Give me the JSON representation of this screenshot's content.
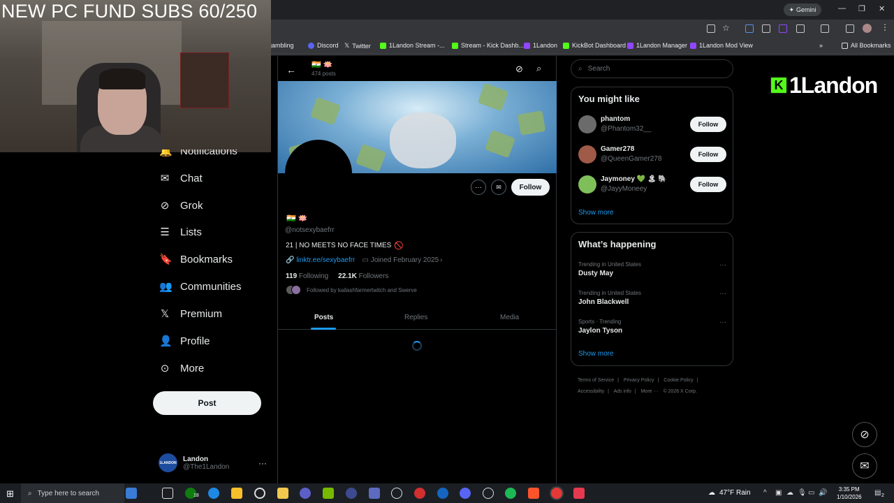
{
  "stream": {
    "overlay_title": "NEW PC FUND SUBS 60/250"
  },
  "browser": {
    "gemini_label": "Gemini",
    "bookmarks": [
      {
        "label": "gambling",
        "color": "#7b5fd6"
      },
      {
        "label": "Discord",
        "color": "#5865f2"
      },
      {
        "label": "Twitter",
        "color": "#000000"
      },
      {
        "label": "1Landon Stream -...",
        "color": "#53fc18"
      },
      {
        "label": "Stream - Kick Dashb...",
        "color": "#53fc18"
      },
      {
        "label": "1Landon",
        "color": "#9146ff"
      },
      {
        "label": "KickBot Dashboard",
        "color": "#53fc18"
      },
      {
        "label": "1Landon Manager",
        "color": "#9146ff"
      },
      {
        "label": "1Landon Mod View",
        "color": "#9146ff"
      }
    ],
    "all_bookmarks": "All Bookmarks"
  },
  "nav": {
    "items": [
      {
        "label": "Notifications",
        "icon": "bell-icon"
      },
      {
        "label": "Chat",
        "icon": "mail-icon"
      },
      {
        "label": "Grok",
        "icon": "grok-icon"
      },
      {
        "label": "Lists",
        "icon": "list-icon"
      },
      {
        "label": "Bookmarks",
        "icon": "bookmark-icon"
      },
      {
        "label": "Communities",
        "icon": "people-icon"
      },
      {
        "label": "Premium",
        "icon": "x-logo-icon"
      },
      {
        "label": "Profile",
        "icon": "person-icon"
      },
      {
        "label": "More",
        "icon": "more-circle-icon"
      }
    ],
    "post_label": "Post",
    "account": {
      "name": "Landon",
      "handle": "@The1Landon",
      "avatar_text": "1LANDON"
    }
  },
  "profile": {
    "header_flags": "🇮🇳 🪷",
    "posts_count": "474 posts",
    "flags": "🇮🇳 🪷",
    "handle": "@notsexybaefrr",
    "bio": "21 | NO MEETS NO FACE TIMES",
    "link": "linktr.ee/sexybaefrr",
    "joined": "Joined February 2025",
    "following_count": "119",
    "following_label": "Following",
    "followers_count": "22.1K",
    "followers_label": "Followers",
    "followed_by": "Followed by kailashfarmertwitch and Swerve",
    "follow_label": "Follow",
    "tabs": [
      "Posts",
      "Replies",
      "Media"
    ]
  },
  "sidebar": {
    "search_placeholder": "Search",
    "you_might_like_title": "You might like",
    "suggestions": [
      {
        "name": "phantom",
        "handle": "@Phantom32__",
        "follow": "Follow",
        "color": "#6b6b6b"
      },
      {
        "name": "Gamer278",
        "handle": "@QueenGamer278",
        "follow": "Follow",
        "color": "#a05a48"
      },
      {
        "name": "Jaymoney 💚 🏝 🐘",
        "handle": "@JayyMoneey",
        "follow": "Follow",
        "color": "#7fbf5a"
      }
    ],
    "show_more": "Show more",
    "whats_happening_title": "What’s happening",
    "trends": [
      {
        "context": "Trending in United States",
        "topic": "Dusty May"
      },
      {
        "context": "Trending in United States",
        "topic": "John Blackwell"
      },
      {
        "context": "Sports · Trending",
        "topic": "Jaylon Tyson"
      }
    ],
    "footer": [
      "Terms of Service",
      "|",
      "Privacy Policy",
      "|",
      "Cookie Policy",
      "|",
      "Accessibility",
      "|",
      "Ads info",
      "|",
      "More ···",
      "© 2026 X Corp."
    ]
  },
  "kick": {
    "logo_text": "1Landon",
    "logo_mark": "K"
  },
  "taskbar": {
    "search_placeholder": "Type here to search",
    "weather": "47°F  Rain",
    "time": "3:35 PM",
    "date": "1/10/2026",
    "badge": "18",
    "notif_count": "2"
  }
}
